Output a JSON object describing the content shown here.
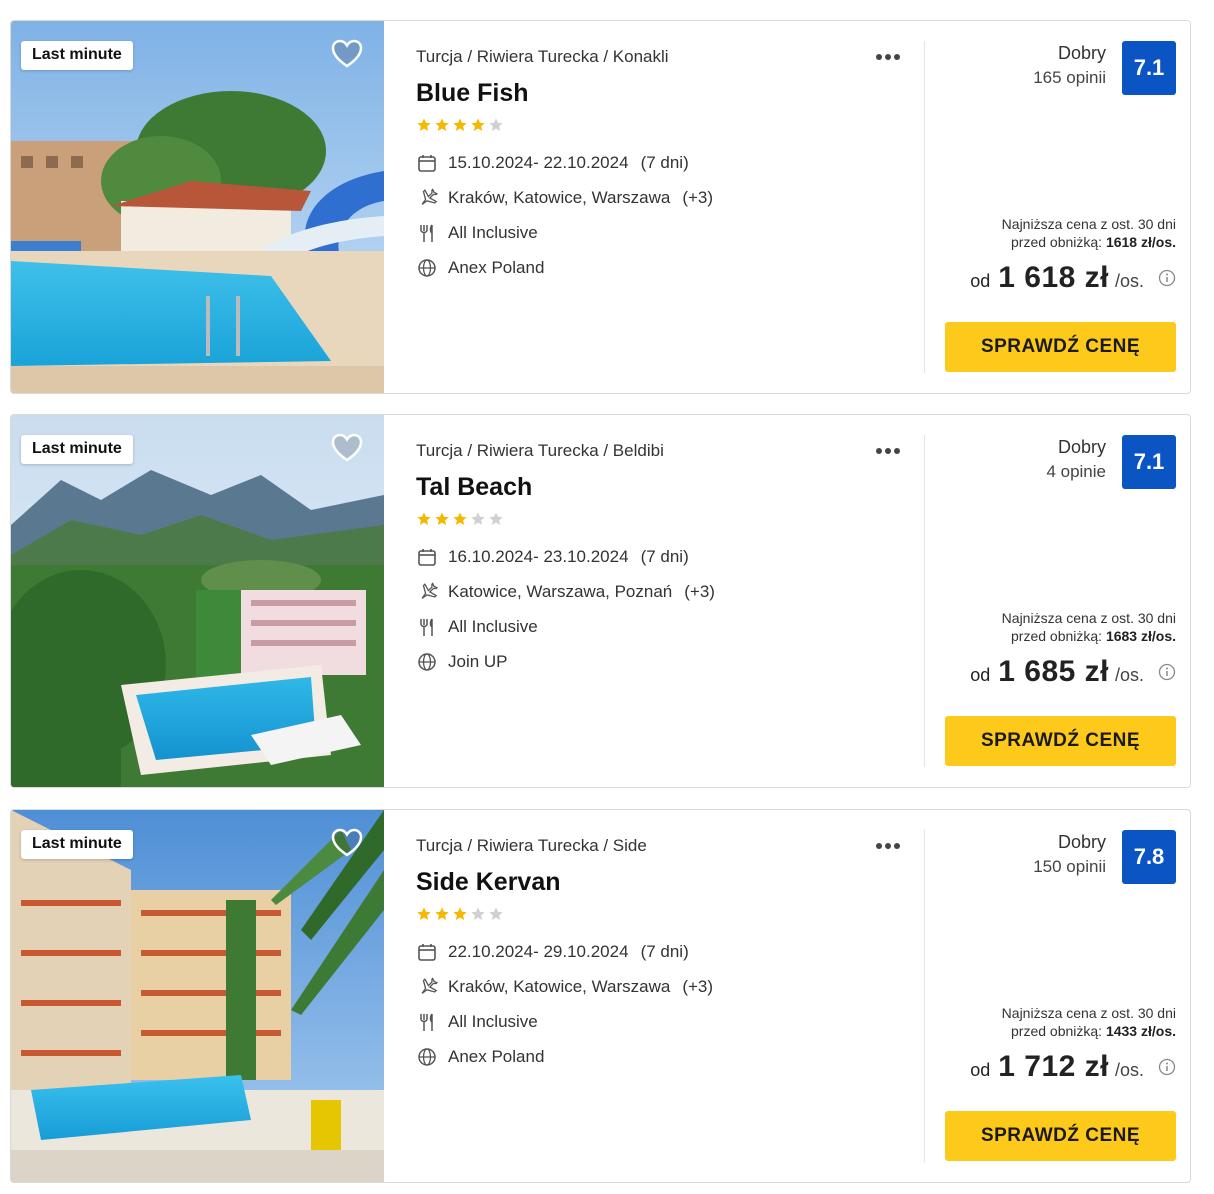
{
  "offers": [
    {
      "badge": "Last minute",
      "breadcrumb": "Turcja / Riwiera Turecka / Konakli",
      "name": "Blue Fish",
      "stars": 4,
      "dates": "15.10.2024- 22.10.2024",
      "duration": "(7 dni)",
      "departures": "Kraków, Katowice, Warszawa",
      "departures_more": "(+3)",
      "board": "All Inclusive",
      "operator": "Anex Poland",
      "rating_label": "Dobry",
      "reviews": "165 opinii",
      "score": "7.1",
      "lowest_line1": "Najniższa cena z ost. 30 dni",
      "lowest_prefix": "przed obniżką:",
      "lowest_value": "1618 zł/os.",
      "price_prefix": "od",
      "price": "1 618 zł",
      "price_suffix": "/os.",
      "cta": "SPRAWDŹ CENĘ"
    },
    {
      "badge": "Last minute",
      "breadcrumb": "Turcja / Riwiera Turecka / Beldibi",
      "name": "Tal Beach",
      "stars": 3,
      "dates": "16.10.2024- 23.10.2024",
      "duration": "(7 dni)",
      "departures": "Katowice, Warszawa, Poznań",
      "departures_more": "(+3)",
      "board": "All Inclusive",
      "operator": "Join UP",
      "rating_label": "Dobry",
      "reviews": "4 opinie",
      "score": "7.1",
      "lowest_line1": "Najniższa cena z ost. 30 dni",
      "lowest_prefix": "przed obniżką:",
      "lowest_value": "1683 zł/os.",
      "price_prefix": "od",
      "price": "1 685 zł",
      "price_suffix": "/os.",
      "cta": "SPRAWDŹ CENĘ"
    },
    {
      "badge": "Last minute",
      "breadcrumb": "Turcja / Riwiera Turecka / Side",
      "name": "Side Kervan",
      "stars": 3,
      "dates": "22.10.2024- 29.10.2024",
      "duration": "(7 dni)",
      "departures": "Kraków, Katowice, Warszawa",
      "departures_more": "(+3)",
      "board": "All Inclusive",
      "operator": "Anex Poland",
      "rating_label": "Dobry",
      "reviews": "150 opinii",
      "score": "7.8",
      "lowest_line1": "Najniższa cena z ost. 30 dni",
      "lowest_prefix": "przed obniżką:",
      "lowest_value": "1433 zł/os.",
      "price_prefix": "od",
      "price": "1 712 zł",
      "price_suffix": "/os.",
      "cta": "SPRAWDŹ CENĘ"
    }
  ],
  "colors": {
    "score_bg": "#0a55c3",
    "cta_bg": "#fdc91b",
    "star_on": "#f5b800",
    "star_off": "#d0d0d0"
  }
}
